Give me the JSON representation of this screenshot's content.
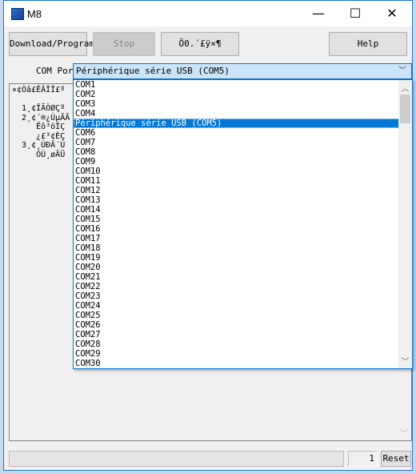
{
  "window": {
    "title": "M8",
    "minimize": "—",
    "maximize": "☐",
    "close": "✕"
  },
  "toolbar": {
    "download": "Download/Program",
    "stop": "Stop",
    "garbled": "Õ0.´£ÿ×¶",
    "help": "Help"
  },
  "com": {
    "label": "COM Port",
    "selected": "Périphérique série USB (COM5)"
  },
  "dropdown": {
    "items": [
      "COM1",
      "COM2",
      "COM3",
      "COM4",
      "Périphérique série USB (COM5)",
      "COM6",
      "COM7",
      "COM8",
      "COM9",
      "COM10",
      "COM11",
      "COM12",
      "COM13",
      "COM14",
      "COM15",
      "COM16",
      "COM17",
      "COM18",
      "COM19",
      "COM20",
      "COM21",
      "COM22",
      "COM23",
      "COM24",
      "COM25",
      "COM26",
      "COM27",
      "COM28",
      "COM29",
      "COM30"
    ],
    "selected_index": 4
  },
  "log": {
    "text": "×¢Òâ£ÊÂÎÎ£º\n\n  1¸¢ÎÃÒØÇº\n  2¸¢´®¿ÚµÄÃ\n     Ëô³öÎÇ\n     ¿£³¢ÈÇ\n  3¸¢¸ÚÐÂ´Ú\n     ÔÙ¸øÄÜ"
  },
  "status": {
    "count": "1",
    "reset": "Reset"
  }
}
